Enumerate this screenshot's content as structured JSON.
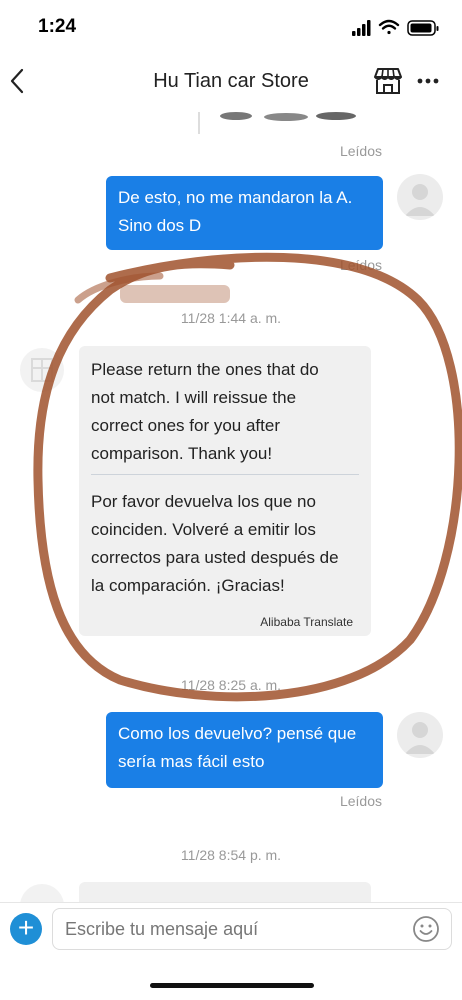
{
  "status": {
    "time": "1:24"
  },
  "header": {
    "title": "Hu Tian car Store"
  },
  "messages": {
    "read_label_1": "Leídos",
    "out_1": {
      "line1": "De esto, no me mandaron la A.",
      "line2": "Sino dos D",
      "read": "Leídos"
    },
    "ts_1": "11/28 1:44 a. m.",
    "in_1": {
      "original": [
        "Please return the ones that do",
        "not match. I will reissue the",
        "correct ones for you after",
        "comparison. Thank you!"
      ],
      "translated": [
        "Por favor devuelva los que no",
        "coinciden. Volveré a emitir los",
        "correctos para usted después de",
        "la comparación. ¡Gracias!"
      ],
      "translator": "Alibaba Translate"
    },
    "ts_2": "11/28 8:25 a. m.",
    "out_2": {
      "line1": "Como los devuelvo? pensé que",
      "line2": "sería mas fácil esto",
      "read": "Leídos"
    },
    "ts_3": "11/28 8:54 p. m."
  },
  "composer": {
    "placeholder": "Escribe tu mensaje aquí",
    "add_label": "+"
  },
  "colors": {
    "accent": "#1a7fe6",
    "annotation": "#a0522d"
  },
  "icons": [
    "back-icon",
    "store-icon",
    "more-icon",
    "emoji-icon",
    "plus-icon",
    "signal-icon",
    "wifi-icon",
    "battery-icon"
  ]
}
